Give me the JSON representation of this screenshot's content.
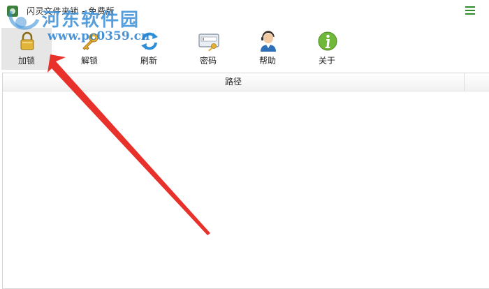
{
  "window": {
    "title": "闪灵文件夹锁 - 免费版"
  },
  "watermark": {
    "site_name": "河东软件园",
    "url": "www.pc0359.cn"
  },
  "toolbar": {
    "buttons": [
      {
        "label": "加锁",
        "icon": "lock-icon",
        "active": true
      },
      {
        "label": "解锁",
        "icon": "key-icon",
        "active": false
      },
      {
        "label": "刷新",
        "icon": "refresh-icon",
        "active": false
      },
      {
        "label": "密码",
        "icon": "password-icon",
        "active": false
      },
      {
        "label": "帮助",
        "icon": "help-icon",
        "active": false
      },
      {
        "label": "关于",
        "icon": "info-icon",
        "active": false
      }
    ]
  },
  "table": {
    "columns": [
      "路径"
    ],
    "rows": []
  },
  "colors": {
    "accent_green": "#2e8b2e",
    "watermark_blue": "#3a8fd6",
    "annotation_red": "#e8312a"
  }
}
